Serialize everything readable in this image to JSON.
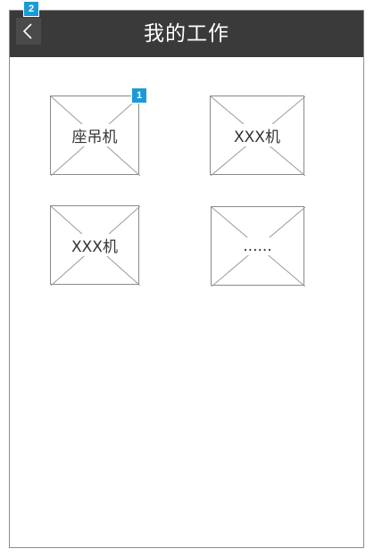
{
  "header": {
    "title": "我的工作",
    "back_badge": "2",
    "back_icon": "chevron-left-icon"
  },
  "tiles": [
    {
      "label": "座吊机",
      "badge": "1"
    },
    {
      "label": "XXX机"
    },
    {
      "label": "XXX机"
    },
    {
      "label": "......"
    }
  ],
  "colors": {
    "header_bg": "#3a3a3a",
    "badge": "#1a9bd7"
  }
}
